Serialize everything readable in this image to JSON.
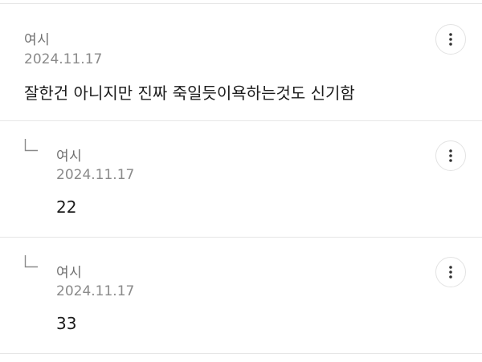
{
  "comments": [
    {
      "author": "여시",
      "date": "2024.11.17",
      "text": "잘한건 아니지만 진짜 죽일듯이욕하는것도 신기함",
      "is_reply": false,
      "more_icon": "more-vertical-icon"
    },
    {
      "author": "여시",
      "date": "2024.11.17",
      "text": "22",
      "is_reply": true,
      "reply_icon": "reply-arrow-icon",
      "more_icon": "more-vertical-icon"
    },
    {
      "author": "여시",
      "date": "2024.11.17",
      "text": "33",
      "is_reply": true,
      "reply_icon": "reply-arrow-icon",
      "more_icon": "more-vertical-icon"
    }
  ],
  "colors": {
    "divider": "#e6e6e6",
    "author": "#6f6f6f",
    "date": "#8a8a8a",
    "text": "#1c1c1c"
  }
}
